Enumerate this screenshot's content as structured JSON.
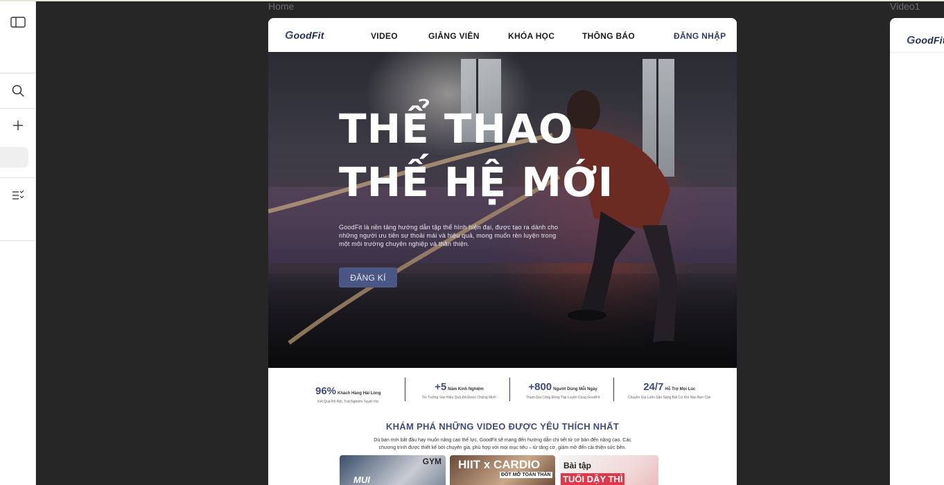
{
  "canvas": {
    "frame_label_home": "Home",
    "frame_label_video": "Video1"
  },
  "toolbar": {
    "icons": [
      "sidebar-toggle-icon",
      "search-icon",
      "plus-icon",
      "list-check-icon"
    ]
  },
  "site": {
    "logo_initial": "G",
    "logo_rest": "oodFit",
    "nav": [
      "VIDEO",
      "GIẢNG VIÊN",
      "KHÓA HỌC",
      "THÔNG BÁO"
    ],
    "login": "ĐĂNG NHẬP",
    "hero": {
      "title_line1": "THỂ THAO",
      "title_line2": "THẾ HỆ MỚI",
      "description": "GoodFit là nền tảng hướng dẫn tập thể hình hiện đại, được tạo ra dành cho những người ưu tiên sự thoải mái và hiệu quả, mong muốn rèn luyện trong một môi trường chuyên nghiệp và thân thiện.",
      "cta": "ĐĂNG KÍ"
    },
    "stats": [
      {
        "value": "96%",
        "label": "Khách Hàng Hài Lòng",
        "sub": "Kết Quả Rõ Rệt, Trải Nghiệm Tuyệt Vời"
      },
      {
        "value": "+5",
        "label": "Năm Kinh Nghiệm",
        "sub": "Tin Tưởng Vào Hiệu Quả Đã Được Chứng Minh"
      },
      {
        "value": "+800",
        "label": "Người Dùng Mỗi Ngày",
        "sub": "Tham Gia Cộng Đồng Tập Luyện Cùng GoodFit"
      },
      {
        "value": "24/7",
        "label": "Hỗ Trợ Mọi Lúc",
        "sub": "Chuyên Gia Luôn Sẵn Sàng Bất Cứ Khi Nào Bạn Cần"
      }
    ],
    "section": {
      "title": "KHÁM PHÁ NHỮNG VIDEO ĐƯỢC YÊU THÍCH NHẤT",
      "description": "Dù bạn mới bắt đầu hay muốn nâng cao thể lực, GoodFit sẽ mang đến hướng dẫn chi tiết từ cơ bản đến nâng cao. Các chương trình được thiết kế bởi chuyên gia, phù hợp với mọi mục tiêu – từ tăng cơ, giảm mỡ đến cải thiện sức bền."
    },
    "thumbnails": [
      {
        "text1": "GYM",
        "text2": "MUI"
      },
      {
        "text1": "HIIT x CARDIO",
        "text2": "ĐỐT MỠ TOÀN THÂN"
      },
      {
        "text1": "Bài tập",
        "text2": "TUỔI DẬY THÌ"
      }
    ]
  },
  "preview2": {
    "logo_initial": "G",
    "logo_rest": "oodFit"
  },
  "colors": {
    "brand_navy": "#3f4d7a",
    "button": "#4a5684",
    "canvas_bg": "#1e1e1e"
  }
}
